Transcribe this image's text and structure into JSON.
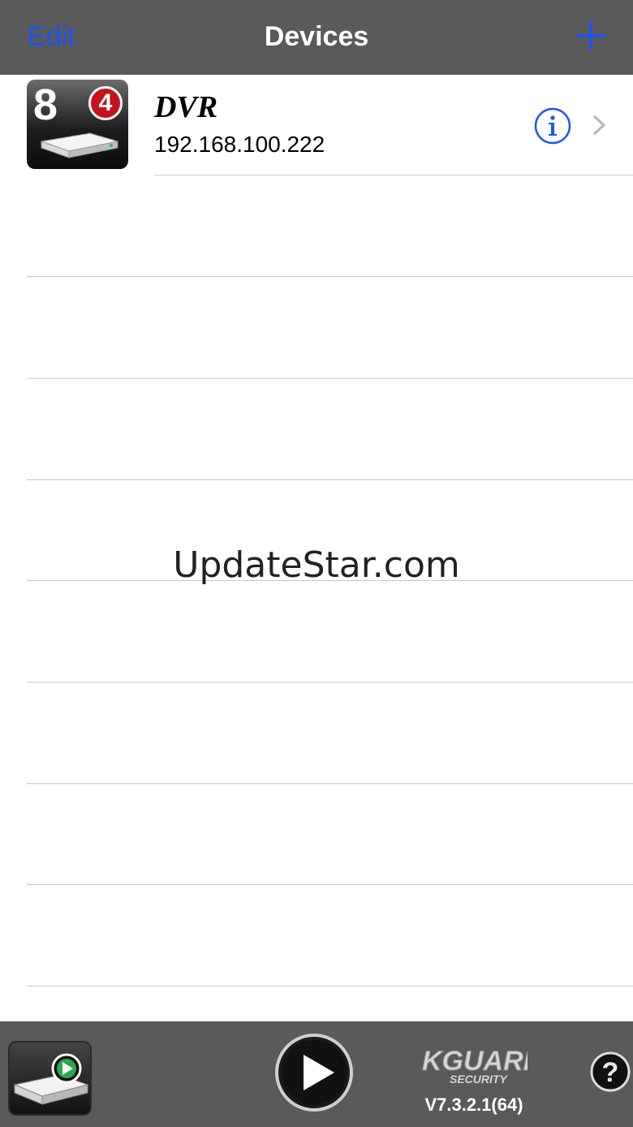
{
  "navbar": {
    "edit_label": "Edit",
    "title": "Devices",
    "add_icon": "plus-icon"
  },
  "devices": [
    {
      "name": "DVR",
      "ip": "192.168.100.222",
      "channels": "8",
      "badge": "4",
      "icon": "dvr-device-icon"
    }
  ],
  "watermark": "UpdateStar.com",
  "toolbar": {
    "devices_icon": "dvr-play-icon",
    "play_icon": "play-icon",
    "logo_text": "KGUARD",
    "logo_subtext": "SECURITY",
    "version": "V7.3.2.1(64)",
    "help_icon": "help-icon"
  },
  "colors": {
    "bar_background": "#5a5a5a",
    "accent": "#1a53ff",
    "badge_red": "#c4131a"
  }
}
